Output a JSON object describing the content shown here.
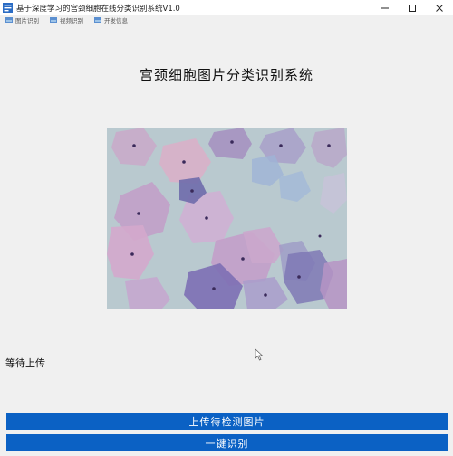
{
  "window": {
    "title": "基于深度学习的宫颈细胞在线分类识别系统V1.0",
    "icon": "app-icon"
  },
  "menu": {
    "items": [
      {
        "label": "图片识别",
        "icon": "image-icon"
      },
      {
        "label": "视频识别",
        "icon": "video-icon"
      },
      {
        "label": "开发信息",
        "icon": "info-icon"
      }
    ]
  },
  "main": {
    "heading": "宫颈细胞图片分类识别系统",
    "status": "等待上传"
  },
  "buttons": {
    "upload_label": "上传待检测图片",
    "recognize_label": "一键识别"
  },
  "colors": {
    "button_bg": "#0b61c4",
    "background": "#f0f0f0"
  }
}
